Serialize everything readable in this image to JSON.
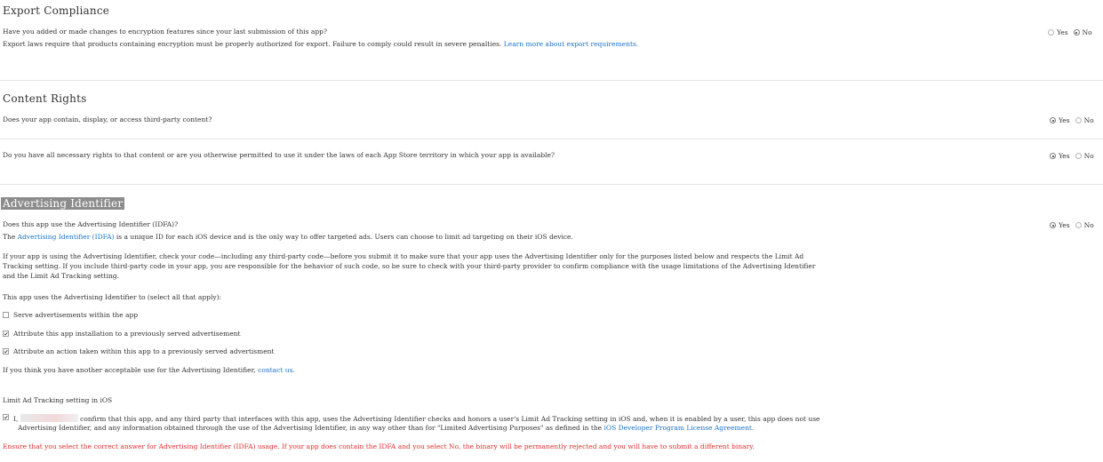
{
  "export_compliance": {
    "heading": "Export Compliance",
    "question": "Have you added or made changes to encryption features since your last submission of this app?",
    "note": "Export laws require that products containing encryption must be properly authorized for export. Failure to comply could result in severe penalties.",
    "link": "Learn more about export requirements.",
    "yes": "Yes",
    "no": "No",
    "selected": "No"
  },
  "content_rights": {
    "heading": "Content Rights",
    "q1": "Does your app contain, display, or access third-party content?",
    "q1_selected": "Yes",
    "q2": "Do you have all necessary rights to that content or are you otherwise permitted to use it under the laws of each App Store territory in which your app is available?",
    "q2_selected": "Yes",
    "yes": "Yes",
    "no": "No"
  },
  "advertising": {
    "heading": "Advertising Identifier",
    "question": "Does this app use the Advertising Identifier (IDFA)?",
    "selected": "Yes",
    "yes": "Yes",
    "no": "No",
    "desc_pre": "The",
    "desc_link": "Advertising Identifier (IDFA)",
    "desc_post": "is a unique ID for each iOS device and is the only way to offer targeted ads. Users can choose to limit ad targeting on their iOS device.",
    "para_line1": "If your app is using the Advertising Identifier, check your code—including any third-party code—before you submit it to make sure that your app uses the Advertising Identifier only for the purposes listed below and respects the Limit Ad",
    "para_line2": "Tracking setting. If you include third-party code in your app, you are responsible for the behavior of such code, so be sure to check with your third-party provider to confirm compliance with the usage limitations of the Advertising Identifier",
    "para_line3": "and the Limit Ad Tracking setting.",
    "uses_label": "This app uses the Advertising Identifier to (select all that apply):",
    "options": [
      {
        "label": "Serve advertisements within the app",
        "checked": false
      },
      {
        "label": "Attribute this app installation to a previously served advertisement",
        "checked": true
      },
      {
        "label": "Attribute an action taken within this app to a previously served advertisment",
        "checked": true
      }
    ],
    "other_use_pre": "If you think you have another acceptable use for the Advertising Identifier,",
    "other_use_link": "contact us.",
    "limit_heading": "Limit Ad Tracking setting in iOS",
    "confirm_pre": "I,",
    "confirm_line1": "confirm that this app, and any third party that interfaces with this app, uses the Advertising Identifier checks and honors a user's Limit Ad Tracking setting in iOS and, when it is enabled by a user, this app does not use",
    "confirm_line2_pre": "Advertising Identifier, and any information obtained through the use of the Advertising Identifier, in any way other than for \"Limited Advertising Purposes\" as defined in the",
    "confirm_link": "iOS Developer Program License Agreement.",
    "confirm_checked": true,
    "warning": "Ensure that you select the correct answer for Advertising Identifier (IDFA) usage. If your app does contain the IDFA and you select No, the binary will be permanently rejected and you will have to submit a different binary."
  },
  "colors": {
    "link": "#1a73c9",
    "warning": "#e0302e",
    "heading_highlight": "#8c8c8c"
  }
}
